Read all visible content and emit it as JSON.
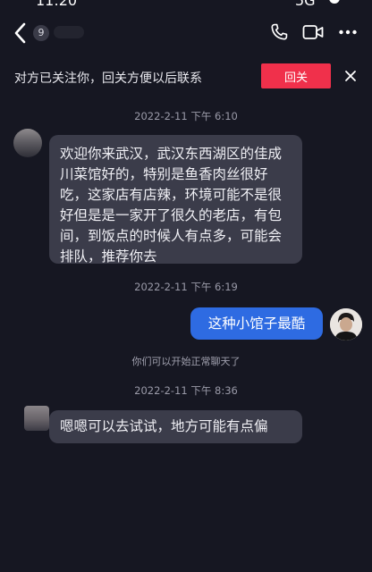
{
  "status_bar": {
    "time": "11:20",
    "signal": "5G"
  },
  "nav": {
    "unread_count": "9"
  },
  "banner": {
    "text": "对方已关注你，回关方便以后联系",
    "follow_back_label": "回关"
  },
  "messages": {
    "timestamp_1": "2022-2-11 下午 6:10",
    "incoming_1": "欢迎你来武汉，武汉东西湖区的佳成川菜馆好的，特别是鱼香肉丝很好吃，这家店有店辣，环境可能不是很好但是是一家开了很久的老店，有包间，到饭点的时候人有点多，可能会排队，推荐你去",
    "timestamp_2": "2022-2-11 下午 6:19",
    "outgoing_1": "这种小馆子最酷",
    "system_note": "你们可以开始正常聊天了",
    "timestamp_3": "2022-2-11 下午 8:36",
    "incoming_2": "嗯嗯可以去试试，地方可能有点偏"
  },
  "colors": {
    "background": "#161722",
    "incoming_bubble": "#3b3c4a",
    "outgoing_bubble": "#2e6be2",
    "follow_button": "#f0304b"
  },
  "icons": {
    "back": "chevron-left-icon",
    "call": "phone-icon",
    "video": "video-camera-icon",
    "more": "more-dots-icon",
    "close": "close-icon"
  }
}
